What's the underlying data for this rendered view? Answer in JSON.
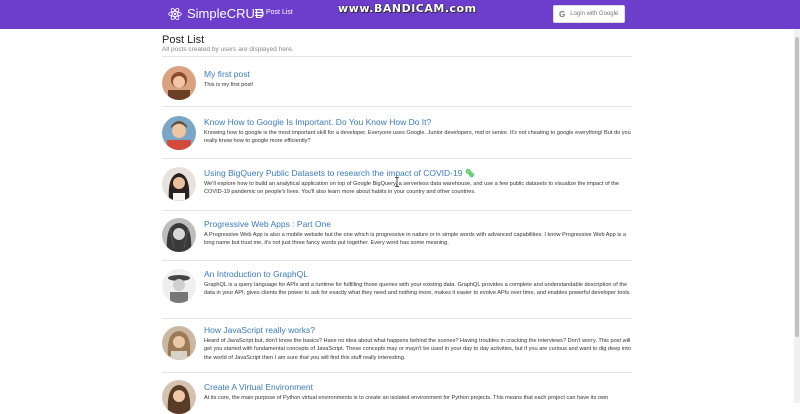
{
  "navbar": {
    "brand": "SimpleCRUD",
    "menu_label": "Post List",
    "watermark": "www.BANDICAM.com",
    "login_label": "Login with Google",
    "login_icon": "G",
    "color": "#6c3ecb"
  },
  "page": {
    "title": "Post List",
    "subtitle": "All posts created by users are displayed here."
  },
  "posts": [
    {
      "title": "My first post",
      "body": "This is my first post!"
    },
    {
      "title": "Know How to Google Is Important. Do You Know How Do It?",
      "body": "Knowing how to google is the most important skill for a developer. Everyone uses Google. Junior developers, mid or senior. It's not cheating to google everything! But do you really know how to google more efficiently?"
    },
    {
      "title": "Using BigQuery Public Datasets to research the impact of COVID-19 🦠",
      "body": "We'll explore how to build an analytical application on top of Google BigQuery, a serverless data warehouse, and use a few public datasets to visualize the impact of the COVID-19 pandemic on people's lives. You'll also learn more about habits in your country and other countries."
    },
    {
      "title": "Progressive Web Apps : Part One",
      "body": "A Progressive Web App is also a mobile website but the one which is progressive in nature or in simple words with advanced capabilities. I know Progressive Web App is a long name but trust me, it's not just three fancy words put together. Every word has some meaning."
    },
    {
      "title": "An Introduction to GraphQL",
      "body": "GraphQL is a query language for APIs and a runtime for fulfilling those queries with your existing data. GraphQL provides a complete and understandable description of the data in your API, gives clients the power to ask for exactly what they need and nothing more, makes it easier to evolve APIs over time, and enables powerful developer tools."
    },
    {
      "title": "How JavaScript really works?",
      "body": "Heard of JavaScript but, don't know the basics? Have no idea about what happens behind the scenes? Having troubles in cracking the interviews? Don't worry. This post will get you started with fundamental concepts of JavaScript. These concepts may or mayn't be used in your day to day activities, but if you are curious and want to dig deep into the world of JavaScript then I am sure that you will find this stuff really interesting."
    },
    {
      "title": "Create A Virtual Environment",
      "body": "At its core, the main purpose of Python virtual environments is to create an isolated environment for Python projects. This means that each project can have its own"
    }
  ]
}
